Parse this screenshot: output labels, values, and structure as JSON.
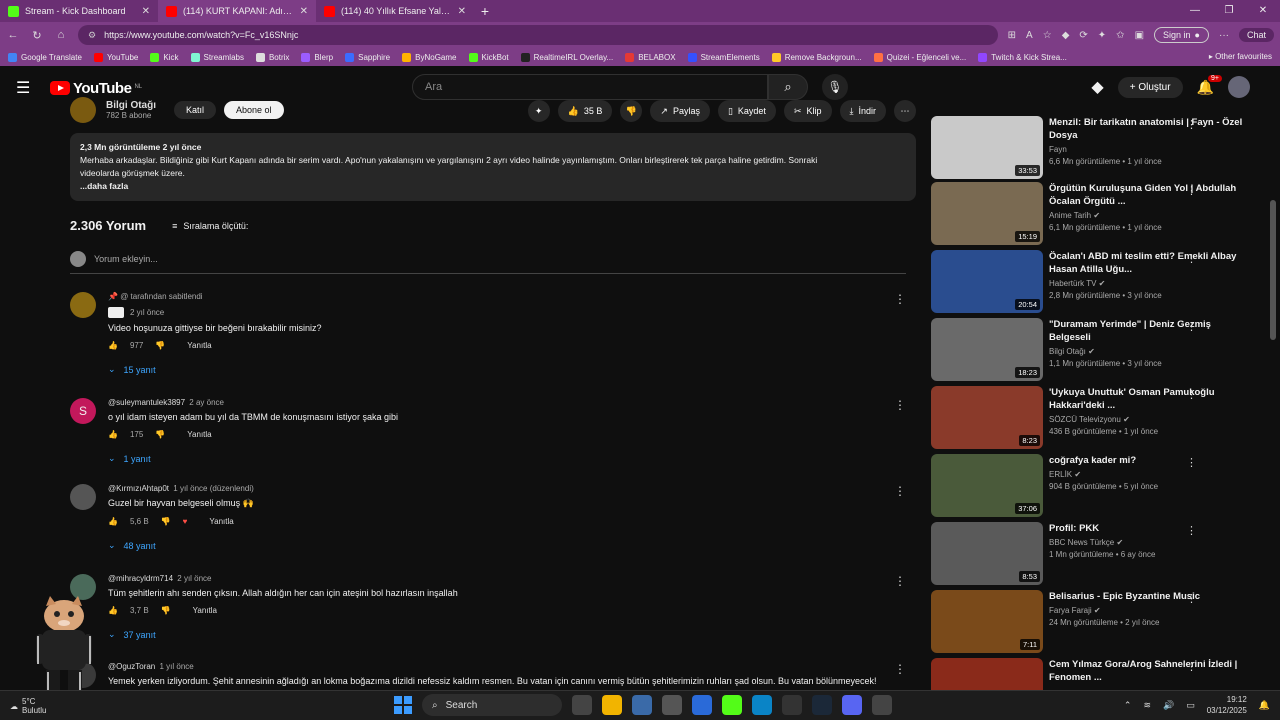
{
  "browser": {
    "tabs": [
      {
        "title": "Stream - Kick Dashboard",
        "color": "#53fc18"
      },
      {
        "title": "(114) KURT KAPANI: Adım Adım",
        "color": "#ff0000"
      },
      {
        "title": "(114) 40 Yıllık Efsane Yalan! - YouTu",
        "color": "#ff0000"
      }
    ],
    "url": "https://www.youtube.com/watch?v=Fc_v16SNnjc",
    "sign_in": "Sign in",
    "chat": "Chat",
    "bookmarks": [
      "Google Translate",
      "YouTube",
      "Kick",
      "Streamlabs",
      "Botrix",
      "Blerp",
      "Sapphire",
      "ByNoGame",
      "KickBot",
      "RealtimeIRL Overlay...",
      "BELABOX",
      "StreamElements",
      "Remove Backgroun...",
      "Quizei - Eğlenceli ve...",
      "Twitch & Kick Strea..."
    ],
    "other_favourites": "Other favourites"
  },
  "youtube": {
    "logo": "YouTube",
    "region": "NL",
    "search_placeholder": "Ara",
    "create_label": "Oluştur",
    "notif_count": "9+"
  },
  "video": {
    "channel_name": "Bilgi Otağı",
    "subs": "782 B abone",
    "join": "Katıl",
    "subscribe": "Abone ol",
    "likes": "35 B",
    "share": "Paylaş",
    "save": "Kaydet",
    "clip": "Klip",
    "download": "İndir",
    "desc_meta": "2,3 Mn görüntüleme  2 yıl önce",
    "desc_line1": "Merhaba arkadaşlar. Bildiğiniz gibi Kurt Kapanı adında bir serim vardı. Apo'nun yakalanışını ve yargılanışını 2 ayrı video halinde yayınlamıştım. Onları birleştirerek tek parça haline getirdim. Sonraki",
    "desc_line2": "videolarda görüşmek üzere.",
    "desc_more": "...daha fazla"
  },
  "comments": {
    "count": "2.306 Yorum",
    "sort": "Sıralama ölçütü:",
    "add_placeholder": "Yorum ekleyin...",
    "items": [
      {
        "pinned": "@ tarafından sabitlendi",
        "user": "",
        "ago": "2 yıl önce",
        "text": "Video hoşunuza gittiyse bir beğeni bırakabilir misiniz?",
        "likes": "977",
        "reply": "Yanıtla",
        "replies": "15 yanıt",
        "avatar_color": "#8a6a12"
      },
      {
        "user": "@suleymantulek3897",
        "ago": "2 ay önce",
        "text": "o yıl idam isteyen adam bu yıl da TBMM de konuşmasını istiyor şaka gibi",
        "likes": "175",
        "reply": "Yanıtla",
        "replies": "1 yanıt",
        "avatar_color": "#c2185b",
        "initial": "S"
      },
      {
        "user": "@KırmızıAhtap0t",
        "ago": "1 yıl önce (düzenlendi)",
        "text": "Guzel bir hayvan belgeseli olmuş 🙌",
        "likes": "5,6 B",
        "reply": "Yanıtla",
        "replies": "48 yanıt",
        "avatar_color": "#555555"
      },
      {
        "user": "@mihracyldrm714",
        "ago": "2 yıl önce",
        "text": "Tüm şehitlerin ahı senden çıksın. Allah aldığın her can için ateşini bol hazırlasın inşallah",
        "likes": "3,7 B",
        "reply": "Yanıtla",
        "replies": "37 yanıt",
        "avatar_color": "#4a6a5a"
      },
      {
        "user": "@OguzToran",
        "ago": "1 yıl önce",
        "text": "Yemek yerken izliyordum. Şehit annesinin ağladığı an lokma boğazıma dizildi nefessiz kaldım resmen. Bu vatan için canını vermiş bütün şehitlerimizin ruhları şad olsun. Bu vatan bölünmeyecek!",
        "likes": "",
        "reply": "",
        "replies": "",
        "avatar_color": "#3a3a3a"
      }
    ]
  },
  "sidebar": {
    "videos": [
      {
        "title": "Menzil: Bir tarikatın anatomisi | Fayn - Özel Dosya",
        "channel": "Fayn",
        "meta": "6,6 Mn görüntüleme • 1 yıl önce",
        "duration": "33:53",
        "verified": false,
        "color": "#c9c9c9"
      },
      {
        "title": "Örgütün Kuruluşuna Giden Yol | Abdullah Öcalan Örgütü ...",
        "channel": "Anime Tarih",
        "meta": "6,1 Mn görüntüleme • 1 yıl önce",
        "duration": "15:19",
        "verified": true,
        "color": "#7a6a52"
      },
      {
        "title": "Öcalan'ı ABD mi teslim etti? Emekli Albay Hasan Atilla Uğu...",
        "channel": "Habertürk TV",
        "meta": "2,8 Mn görüntüleme • 3 yıl önce",
        "duration": "20:54",
        "verified": true,
        "color": "#2a4d8f"
      },
      {
        "title": "\"Duramam Yerimde\" | Deniz Gezmiş Belgeseli",
        "channel": "Bilgi Otağı",
        "meta": "1,1 Mn görüntüleme • 3 yıl önce",
        "duration": "18:23",
        "verified": true,
        "color": "#6a6a6a"
      },
      {
        "title": "'Uykuya Unuttuk' Osman Pamukoğlu Hakkari'deki ...",
        "channel": "SÖZCÜ Televizyonu",
        "meta": "436 B görüntüleme • 1 yıl önce",
        "duration": "8:23",
        "verified": true,
        "color": "#8a3a2a"
      },
      {
        "title": "coğrafya kader mi?",
        "channel": "ERLİK",
        "meta": "904 B görüntüleme • 5 yıl önce",
        "duration": "37:06",
        "verified": true,
        "color": "#4a5a3a"
      },
      {
        "title": "Profil: PKK",
        "channel": "BBC News Türkçe",
        "meta": "1 Mn görüntüleme • 6 ay önce",
        "duration": "8:53",
        "verified": true,
        "color": "#5a5a5a"
      },
      {
        "title": "Belisarius - Epic Byzantine Music",
        "channel": "Farya Faraji",
        "meta": "24 Mn görüntüleme • 2 yıl önce",
        "duration": "7:11",
        "verified": true,
        "color": "#7a4a1a"
      },
      {
        "title": "Cem Yılmaz Gora/Arog Sahnelerini İzledi | Fenomen ...",
        "channel": "",
        "meta": "",
        "duration": "",
        "verified": false,
        "color": "#8a2a1a"
      }
    ]
  },
  "taskbar": {
    "weather": "5°C",
    "weather_sub": "Bulutlu",
    "search": "Search",
    "time": "19:12",
    "date": "03/12/2025"
  }
}
